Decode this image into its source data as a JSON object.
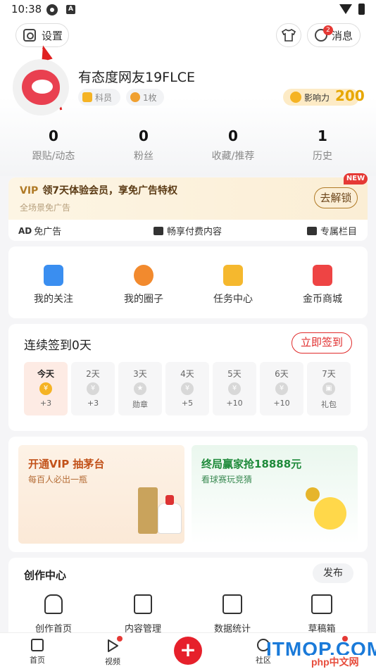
{
  "status_bar": {
    "time": "10:38",
    "icon_a_text": "A"
  },
  "header": {
    "settings_label": "设置",
    "message_label": "消息",
    "message_badge": "2"
  },
  "profile": {
    "username": "有态度网友19FLCE",
    "level_tag": "科员",
    "badge_tag": "1枚",
    "influence_label": "影响力",
    "influence_value": "200"
  },
  "stats": [
    {
      "value": "0",
      "label": "跟贴/动态"
    },
    {
      "value": "0",
      "label": "粉丝"
    },
    {
      "value": "0",
      "label": "收藏/推荐"
    },
    {
      "value": "1",
      "label": "历史"
    }
  ],
  "vip": {
    "vip_mark": "VIP",
    "title": "领7天体验会员，享免广告特权",
    "subtitle": "全场景免广告",
    "button": "去解锁",
    "new_badge": "NEW",
    "perks": [
      {
        "prefix": "AD",
        "label": "免广告"
      },
      {
        "label": "畅享付费内容"
      },
      {
        "label": "专属栏目"
      }
    ]
  },
  "quick_functions": [
    {
      "label": "我的关注",
      "color": "#3a8ef0"
    },
    {
      "label": "我的圈子",
      "color": "#f28a2e"
    },
    {
      "label": "任务中心",
      "color": "#f5b82e"
    },
    {
      "label": "金币商城",
      "color": "#ee4444"
    }
  ],
  "signin": {
    "title": "连续签到0天",
    "button": "立即签到",
    "days": [
      {
        "day": "今天",
        "coin": "¥",
        "reward": "+3"
      },
      {
        "day": "2天",
        "coin": "¥",
        "reward": "+3"
      },
      {
        "day": "3天",
        "coin": "★",
        "reward": "勋章"
      },
      {
        "day": "4天",
        "coin": "¥",
        "reward": "+5"
      },
      {
        "day": "5天",
        "coin": "¥",
        "reward": "+10"
      },
      {
        "day": "6天",
        "coin": "¥",
        "reward": "+10"
      },
      {
        "day": "7天",
        "coin": "▣",
        "reward": "礼包"
      }
    ]
  },
  "promos": [
    {
      "title": "开通VIP 抽茅台",
      "subtitle": "每百人必出一瓶"
    },
    {
      "title": "终局赢家抢18888元",
      "subtitle": "看球赛玩竞猜"
    }
  ],
  "create_center": {
    "title": "创作中心",
    "publish": "发布",
    "items": [
      {
        "label": "创作首页"
      },
      {
        "label": "内容管理"
      },
      {
        "label": "数据统计"
      },
      {
        "label": "草稿箱"
      }
    ]
  },
  "bottom_nav": [
    {
      "label": "首页"
    },
    {
      "label": "视频"
    },
    {
      "label": "社区"
    }
  ],
  "fab": "+",
  "watermark": {
    "main": "ITMOP.COM",
    "small": "php中文网"
  }
}
